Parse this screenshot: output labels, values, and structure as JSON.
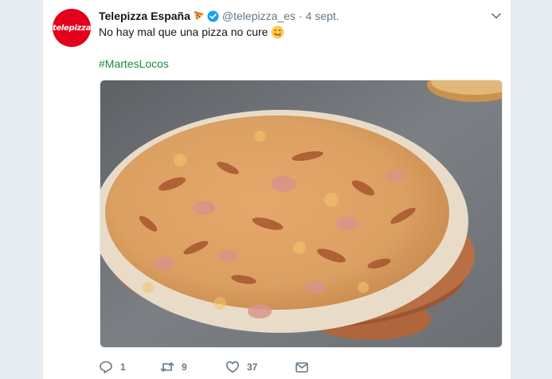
{
  "tweet": {
    "avatar_text": "telepizza",
    "name": "Telepizza España",
    "handle": "@telepizza_es",
    "separator": "·",
    "date": "4 sept.",
    "text": "No hay mal que una pizza no cure",
    "hashtag": "#MartesLocos"
  },
  "actions": {
    "replies": "1",
    "retweets": "9",
    "likes": "37"
  },
  "colors": {
    "brand_red": "#e3001b",
    "hashtag_green": "#1b8c3e",
    "verified_blue": "#1da1f2",
    "muted": "#657786"
  },
  "icons": {
    "name_emoji": "pizza-icon",
    "verified": "verified-badge-icon",
    "menu": "chevron-down-icon",
    "text_emoji": "yum-face-icon",
    "reply": "reply-icon",
    "retweet": "retweet-icon",
    "like": "heart-icon",
    "dm": "mail-icon"
  }
}
